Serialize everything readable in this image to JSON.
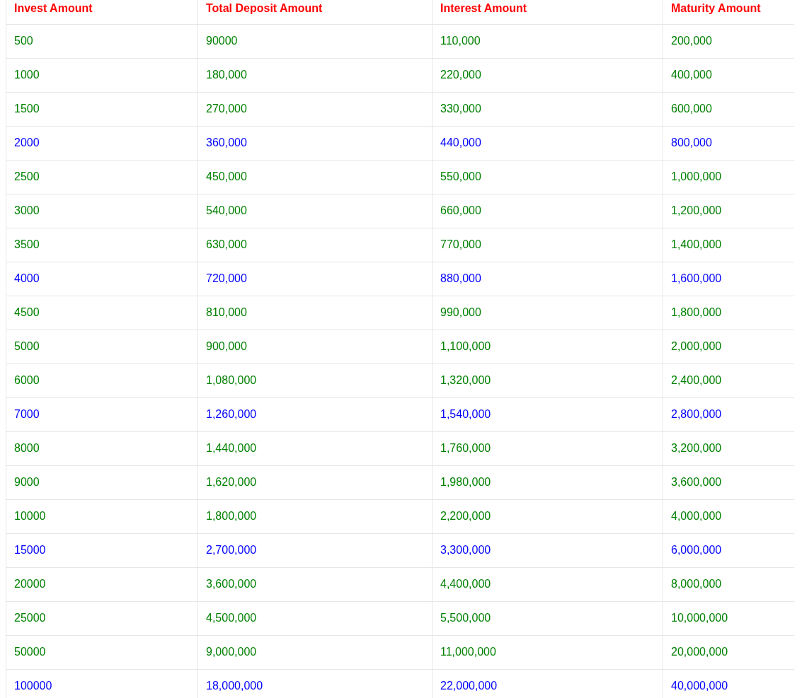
{
  "table": {
    "columns": [
      "Invest Amount",
      "Total Deposit Amount",
      "Interest Amount",
      "Maturity Amount"
    ],
    "rows": [
      {
        "cells": [
          "500",
          "90000",
          "110,000",
          "200,000"
        ],
        "color": "#008000"
      },
      {
        "cells": [
          "1000",
          "180,000",
          "220,000",
          "400,000"
        ],
        "color": "#008000"
      },
      {
        "cells": [
          "1500",
          "270,000",
          "330,000",
          "600,000"
        ],
        "color": "#008000"
      },
      {
        "cells": [
          "2000",
          "360,000",
          "440,000",
          "800,000"
        ],
        "color": "#0000ff"
      },
      {
        "cells": [
          "2500",
          "450,000",
          "550,000",
          "1,000,000"
        ],
        "color": "#008000"
      },
      {
        "cells": [
          "3000",
          "540,000",
          "660,000",
          "1,200,000"
        ],
        "color": "#008000"
      },
      {
        "cells": [
          "3500",
          "630,000",
          "770,000",
          "1,400,000"
        ],
        "color": "#008000"
      },
      {
        "cells": [
          "4000",
          "720,000",
          "880,000",
          "1,600,000"
        ],
        "color": "#0000ff"
      },
      {
        "cells": [
          "4500",
          "810,000",
          "990,000",
          "1,800,000"
        ],
        "color": "#008000"
      },
      {
        "cells": [
          "5000",
          "900,000",
          "1,100,000",
          "2,000,000"
        ],
        "color": "#008000"
      },
      {
        "cells": [
          "6000",
          "1,080,000",
          "1,320,000",
          "2,400,000"
        ],
        "color": "#008000"
      },
      {
        "cells": [
          "7000",
          "1,260,000",
          "1,540,000",
          "2,800,000"
        ],
        "color": "#0000ff"
      },
      {
        "cells": [
          "8000",
          "1,440,000",
          "1,760,000",
          "3,200,000"
        ],
        "color": "#008000"
      },
      {
        "cells": [
          "9000",
          "1,620,000",
          "1,980,000",
          "3,600,000"
        ],
        "color": "#008000"
      },
      {
        "cells": [
          "10000",
          "1,800,000",
          "2,200,000",
          "4,000,000"
        ],
        "color": "#008000"
      },
      {
        "cells": [
          "15000",
          "2,700,000",
          "3,300,000",
          "6,000,000"
        ],
        "color": "#0000ff"
      },
      {
        "cells": [
          "20000",
          "3,600,000",
          "4,400,000",
          "8,000,000"
        ],
        "color": "#008000"
      },
      {
        "cells": [
          "25000",
          "4,500,000",
          "5,500,000",
          "10,000,000"
        ],
        "color": "#008000"
      },
      {
        "cells": [
          "50000",
          "9,000,000",
          "11,000,000",
          "20,000,000"
        ],
        "color": "#008000"
      },
      {
        "cells": [
          "100000",
          "18,000,000",
          "22,000,000",
          "40,000,000"
        ],
        "color": "#0000ff"
      }
    ]
  }
}
